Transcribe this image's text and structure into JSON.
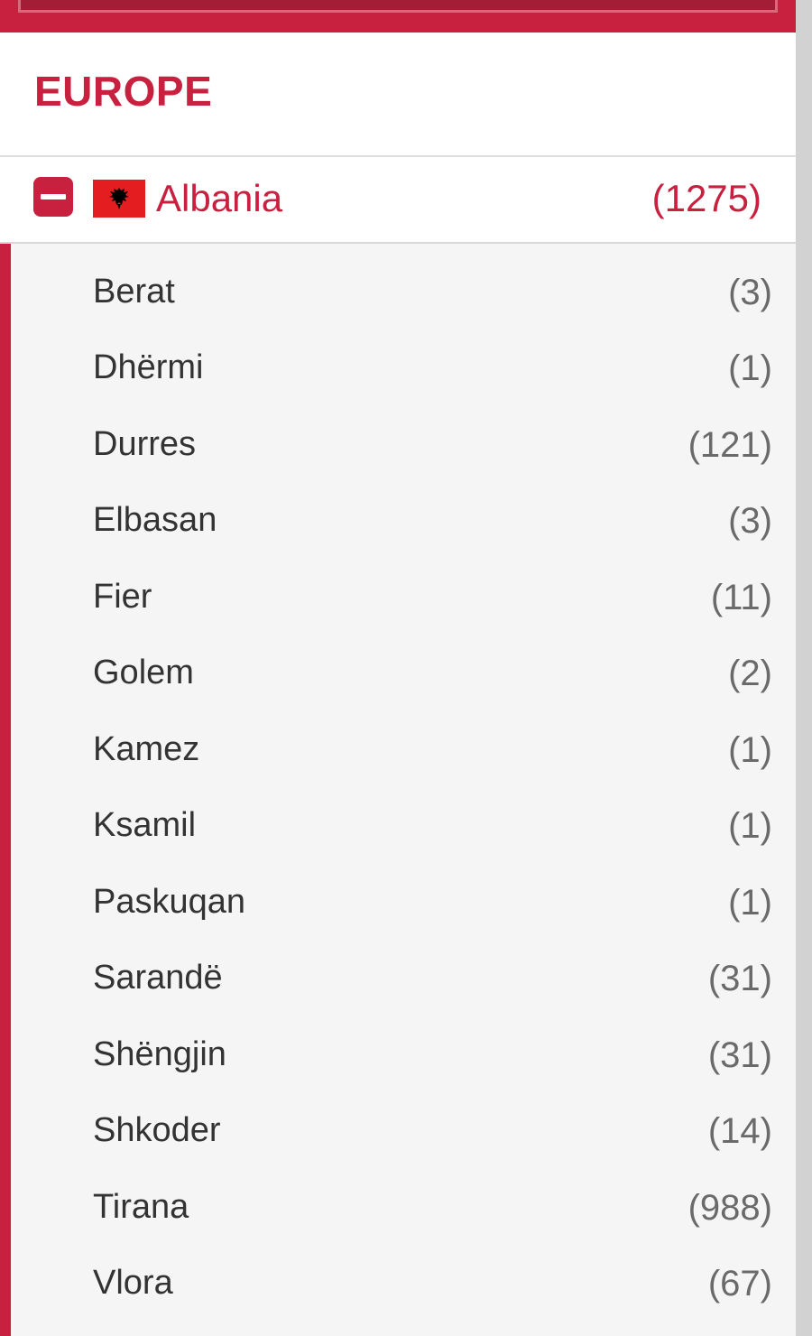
{
  "region": {
    "title": "EUROPE"
  },
  "country": {
    "name": "Albania",
    "count": "(1275)",
    "flag_icon": "albania-flag-icon",
    "toggle_icon": "minus-square-icon"
  },
  "colors": {
    "accent": "#c8203f",
    "list_background": "#f5f5f5",
    "city_text": "#333333",
    "count_text": "#6a6a6a"
  },
  "cities": [
    {
      "name": "Berat",
      "count": "(3)"
    },
    {
      "name": "Dhërmi",
      "count": "(1)"
    },
    {
      "name": "Durres",
      "count": "(121)"
    },
    {
      "name": "Elbasan",
      "count": "(3)"
    },
    {
      "name": "Fier",
      "count": "(11)"
    },
    {
      "name": "Golem",
      "count": "(2)"
    },
    {
      "name": "Kamez",
      "count": "(1)"
    },
    {
      "name": "Ksamil",
      "count": "(1)"
    },
    {
      "name": "Paskuqan",
      "count": "(1)"
    },
    {
      "name": "Sarandë",
      "count": "(31)"
    },
    {
      "name": "Shëngjin",
      "count": "(31)"
    },
    {
      "name": "Shkoder",
      "count": "(14)"
    },
    {
      "name": "Tirana",
      "count": "(988)"
    },
    {
      "name": "Vlora",
      "count": "(67)"
    }
  ]
}
